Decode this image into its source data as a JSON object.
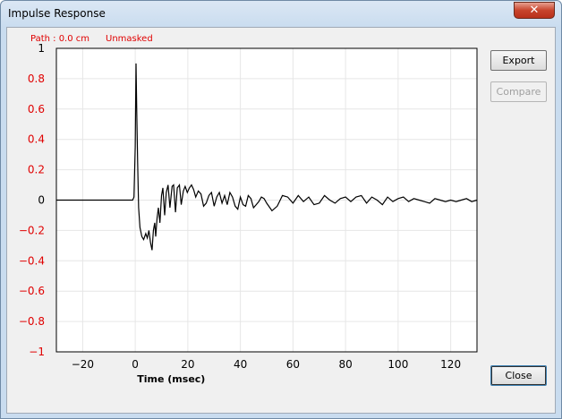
{
  "window": {
    "title": "Impulse Response",
    "close_glyph": "✕"
  },
  "info": {
    "path": "Path : 0.0 cm",
    "mask": "Unmasked"
  },
  "buttons": {
    "export": "Export",
    "compare": "Compare",
    "close": "Close"
  },
  "colors": {
    "positive_tick": "#000000",
    "negative_tick": "#e00000",
    "trace": "#000000"
  },
  "chart_data": {
    "type": "line",
    "title": "",
    "xlabel": "Time (msec)",
    "ylabel": "",
    "xlim": [
      -30,
      130
    ],
    "ylim": [
      -1,
      1
    ],
    "xticks": [
      -20,
      0,
      20,
      40,
      60,
      80,
      100,
      120
    ],
    "yticks": [
      1,
      0.8,
      0.6,
      0.4,
      0.2,
      0,
      -0.2,
      -0.4,
      -0.6,
      -0.8,
      -1
    ],
    "ytick_labels": [
      "1",
      "0.8",
      "0.6",
      "0.4",
      "0.2",
      "0",
      "−0.2",
      "−0.4",
      "−0.6",
      "−0.8",
      "−1"
    ],
    "grid": true,
    "series": [
      {
        "x": [
          -30,
          -1,
          -0.5,
          0,
          0.3,
          0.6,
          0.9,
          1.3,
          1.8,
          2.5,
          3.2,
          4.0,
          4.6,
          5.2,
          5.8,
          6.4,
          6.9,
          7.4,
          7.8,
          8.3,
          8.8,
          9.4,
          10.0,
          10.5,
          11.2,
          11.8,
          12.5,
          13.2,
          14.0,
          14.6,
          15.3,
          16.0,
          16.8,
          17.5,
          18.3,
          19.0,
          19.8,
          20.6,
          21.4,
          22.2,
          23.0,
          24.0,
          25.0,
          26.0,
          27.0,
          28.0,
          29.0,
          30.0,
          31.0,
          32.0,
          33.0,
          34.0,
          35.0,
          36.0,
          37.0,
          38.0,
          39.0,
          40.0,
          41.0,
          42.0,
          43.0,
          44.0,
          45.0,
          46.0,
          47.0,
          48.0,
          49.0,
          50.0,
          52.0,
          54.0,
          56.0,
          58.0,
          60.0,
          62.0,
          64.0,
          66.0,
          68.0,
          70.0,
          72.0,
          74.0,
          76.0,
          78.0,
          80.0,
          82.0,
          84.0,
          86.0,
          88.0,
          90.0,
          92.0,
          94.0,
          96.0,
          98.0,
          100.0,
          102.0,
          104.0,
          106.0,
          108.0,
          110.0,
          112.0,
          114.0,
          116.0,
          118.0,
          120.0,
          122.0,
          124.0,
          126.0,
          128.0,
          130.0
        ],
        "y": [
          0,
          0,
          0.02,
          0.35,
          0.9,
          0.55,
          0.25,
          -0.05,
          -0.18,
          -0.24,
          -0.26,
          -0.22,
          -0.25,
          -0.2,
          -0.28,
          -0.33,
          -0.2,
          -0.15,
          -0.24,
          -0.12,
          -0.05,
          -0.15,
          0.03,
          0.08,
          -0.1,
          0.05,
          0.1,
          -0.05,
          0.09,
          0.1,
          -0.08,
          0.08,
          0.1,
          -0.03,
          0.06,
          0.09,
          0.05,
          0.08,
          0.1,
          0.07,
          0.02,
          0.06,
          0.04,
          -0.04,
          -0.02,
          0.03,
          0.05,
          -0.04,
          0.02,
          0.05,
          -0.02,
          0.03,
          -0.03,
          0.05,
          0.02,
          -0.04,
          -0.06,
          0.02,
          -0.03,
          -0.04,
          0.03,
          0.01,
          -0.05,
          -0.03,
          -0.01,
          0.02,
          0.01,
          -0.02,
          -0.07,
          -0.04,
          0.03,
          0.02,
          -0.02,
          0.03,
          -0.01,
          0.02,
          -0.03,
          -0.02,
          0.03,
          0.0,
          -0.02,
          0.01,
          0.02,
          -0.01,
          0.02,
          0.03,
          -0.02,
          0.02,
          0.0,
          -0.03,
          0.02,
          -0.01,
          0.01,
          0.02,
          -0.01,
          0.01,
          0.0,
          -0.01,
          -0.02,
          0.01,
          0.0,
          -0.01,
          0.0,
          -0.01,
          0.0,
          0.01,
          -0.01,
          0.0
        ]
      }
    ]
  }
}
